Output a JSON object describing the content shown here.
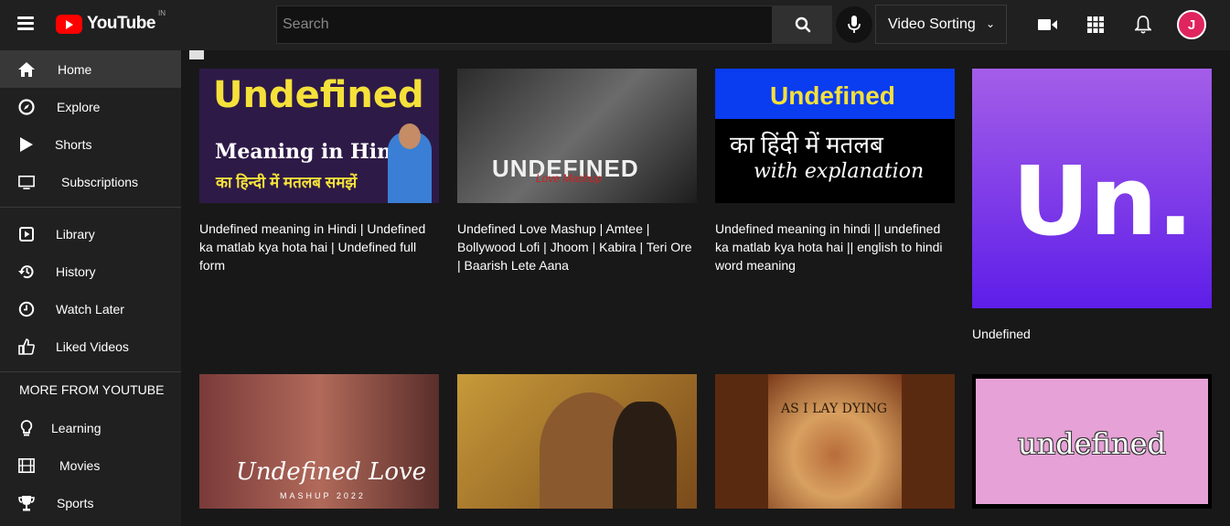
{
  "header": {
    "logo_text": "YouTube",
    "logo_region": "IN",
    "search_placeholder": "Search",
    "sort_label": "Video Sorting",
    "avatar_letter": "J"
  },
  "sidebar": {
    "items": [
      {
        "label": "Home",
        "icon": "home-icon"
      },
      {
        "label": "Explore",
        "icon": "compass-icon"
      },
      {
        "label": "Shorts",
        "icon": "play-icon"
      },
      {
        "label": "Subscriptions",
        "icon": "monitor-icon"
      },
      {
        "label": "Library",
        "icon": "library-icon"
      },
      {
        "label": "History",
        "icon": "history-icon"
      },
      {
        "label": "Watch Later",
        "icon": "clock-icon"
      },
      {
        "label": "Liked Videos",
        "icon": "thumbs-up-icon"
      }
    ],
    "more_heading": "MORE FROM YOUTUBE",
    "more_items": [
      {
        "label": "Learning",
        "icon": "lightbulb-icon"
      },
      {
        "label": "Movies",
        "icon": "film-icon"
      },
      {
        "label": "Sports",
        "icon": "trophy-icon"
      }
    ]
  },
  "videos": [
    {
      "title": "Undefined meaning in Hindi | Undefined ka matlab kya hota hai | Undefined full form",
      "thumb": {
        "line1": "Undefined",
        "line2": "Meaning in Hindi",
        "line3": "का हिन्दी में मतलब समझें"
      }
    },
    {
      "title": "Undefined Love Mashup | Amtee | Bollywood Lofi | Jhoom | Kabira | Teri Ore | Baarish Lete Aana",
      "thumb": {
        "line1": "UNDEFINED",
        "line2": "Love Mashup"
      }
    },
    {
      "title": "Undefined meaning in hindi || undefined ka matlab kya hota hai || english to hindi word meaning",
      "thumb": {
        "line1": "Undefined",
        "line2": "का हिंदी में मतलब",
        "line3": "with explanation"
      }
    },
    {
      "title": "Undefined",
      "thumb": {
        "line1": "Un."
      }
    },
    {
      "title": "",
      "thumb": {
        "line1": "Undefined Love",
        "line2": "MASHUP 2022"
      }
    },
    {
      "title": "",
      "thumb": {}
    },
    {
      "title": "",
      "thumb": {
        "line1": "AS I LAY DYING"
      }
    },
    {
      "title": "",
      "thumb": {
        "line1": "undefined"
      }
    }
  ]
}
